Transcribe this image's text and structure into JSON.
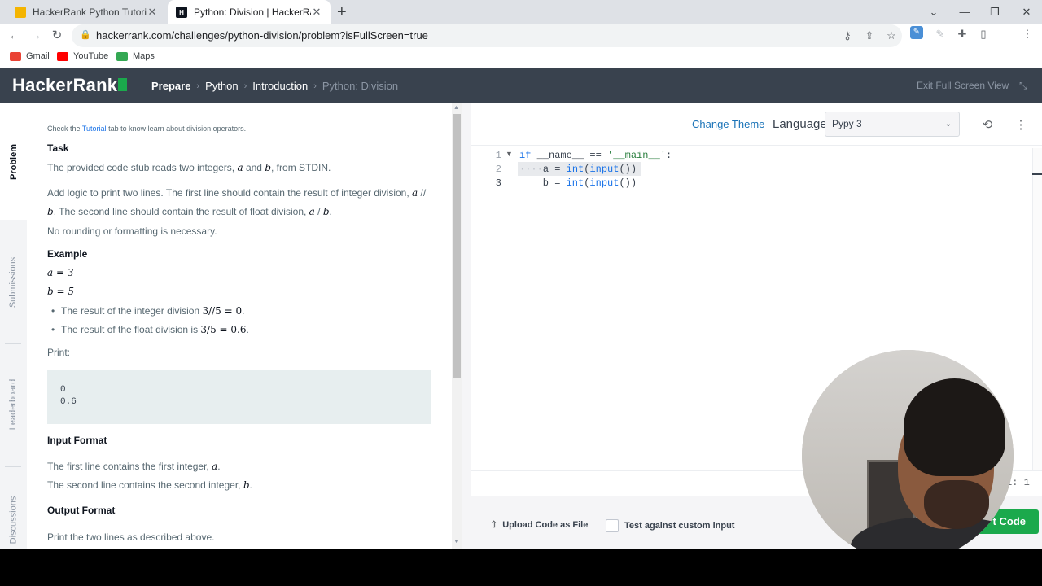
{
  "browser": {
    "tabs": [
      {
        "title": "HackerRank Python Tutorial - Pyt",
        "active": false
      },
      {
        "title": "Python: Division | HackerRank",
        "active": true
      }
    ],
    "url": "hackerrank.com/challenges/python-division/problem?isFullScreen=true",
    "bookmarks": [
      {
        "label": "Gmail",
        "color": "#ea4335"
      },
      {
        "label": "YouTube",
        "color": "#ff0000"
      },
      {
        "label": "Maps",
        "color": "#34a853"
      }
    ]
  },
  "header": {
    "logo": "HackerRank",
    "breadcrumbs": [
      "Prepare",
      "Python",
      "Introduction",
      "Python: Division"
    ],
    "exit_fullscreen": "Exit Full Screen View"
  },
  "side_tabs": [
    "Problem",
    "Submissions",
    "Leaderboard",
    "Discussions"
  ],
  "problem": {
    "hint_before": "Check the ",
    "hint_link": "Tutorial",
    "hint_after": " tab to know learn about division operators.",
    "task_heading": "Task",
    "task_text_1": "The provided code stub reads two integers, ",
    "task_text_2": " and ",
    "task_text_3": ", from STDIN.",
    "logic_text_1": "Add logic to print two lines. The first line should contain the result of integer division, ",
    "logic_text_2": "// ",
    "logic_text_3": ". The second line should contain the result of float division, ",
    "logic_text_4": " / ",
    "no_rounding": "No rounding or formatting is necessary.",
    "example_heading": "Example",
    "a_eq": "a = 3",
    "b_eq": "b = 5",
    "bullet_1_text": "The result of the integer division ",
    "bullet_1_math": "3//5 = 0",
    "bullet_2_text": "The result of the float division is ",
    "bullet_2_math": "3/5 = 0.6",
    "print_label": "Print:",
    "print_lines": [
      "0",
      "0.6"
    ],
    "input_heading": "Input Format",
    "input_line_1": "The first line contains the first integer, ",
    "input_line_2": "The second line contains the second integer, ",
    "output_heading": "Output Format",
    "output_text": "Print the two lines as described above.",
    "var_a": "a",
    "var_b": "b"
  },
  "editor": {
    "change_theme": "Change Theme",
    "language_label": "Language",
    "language_value": "Pypy 3",
    "line_numbers": [
      "1",
      "2",
      "3"
    ],
    "cursor_pos": "1: 1",
    "upload": "Upload Code as File",
    "test_custom": "Test against custom input",
    "submit": "t Code"
  },
  "colors": {
    "brand_green": "#1ba94c",
    "header_bg": "#39424e"
  }
}
